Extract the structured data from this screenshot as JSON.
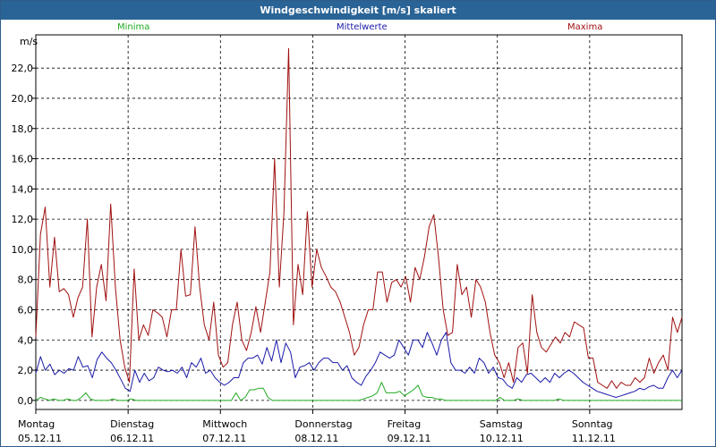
{
  "window": {
    "title": "Windgeschwindigkeit [m/s] skaliert"
  },
  "legend": {
    "min_label": "Minima",
    "mean_label": "Mittelwerte",
    "max_label": "Maxima"
  },
  "colors": {
    "minima": "#22aa22",
    "mittelwerte": "#1a1aa8",
    "maxima": "#a01010",
    "title_bg": "#2a6496"
  },
  "chart_data": {
    "type": "line",
    "title": "Windgeschwindigkeit [m/s] skaliert",
    "ylabel": "m/s",
    "ylim": [
      -0.6,
      24.2
    ],
    "xlim": [
      0,
      7
    ],
    "yticks": [
      "0,0",
      "2,0",
      "4,0",
      "6,0",
      "8,0",
      "10,0",
      "12,0",
      "14,0",
      "16,0",
      "18,0",
      "20,0",
      "22,0"
    ],
    "xticks": [
      {
        "day": "Montag",
        "date": "05.12.11"
      },
      {
        "day": "Dienstag",
        "date": "06.12.11"
      },
      {
        "day": "Mittwoch",
        "date": "07.12.11"
      },
      {
        "day": "Donnerstag",
        "date": "08.12.11"
      },
      {
        "day": "Freitag",
        "date": "09.12.11"
      },
      {
        "day": "Samstag",
        "date": "10.12.11"
      },
      {
        "day": "Sonntag",
        "date": "11.12.11"
      }
    ],
    "grid": true,
    "legend_position": "top",
    "series": [
      {
        "name": "Maxima",
        "values": [
          4.2,
          11.0,
          12.8,
          7.5,
          10.8,
          7.2,
          7.4,
          7.0,
          5.5,
          6.8,
          7.5,
          12.0,
          4.2,
          7.5,
          9.0,
          6.6,
          13.0,
          7.5,
          4.0,
          2.2,
          1.2,
          8.7,
          4.0,
          5.0,
          4.3,
          6.0,
          5.8,
          5.5,
          4.2,
          6.0,
          6.0,
          10.0,
          6.9,
          7.0,
          11.5,
          7.5,
          5.0,
          4.0,
          6.5,
          3.0,
          2.2,
          2.5,
          5.0,
          6.5,
          4.0,
          3.3,
          4.5,
          6.2,
          4.5,
          6.5,
          8.5,
          16.0,
          7.5,
          12.5,
          23.3,
          5.0,
          9.0,
          7.0,
          12.5,
          7.5,
          10.0,
          8.8,
          8.2,
          7.5,
          7.2,
          6.5,
          5.5,
          4.5,
          3.0,
          3.5,
          5.0,
          6.0,
          6.0,
          8.5,
          8.5,
          6.5,
          7.8,
          8.0,
          7.5,
          8.2,
          6.5,
          8.8,
          8.0,
          9.5,
          11.5,
          12.3,
          9.5,
          6.0,
          4.3,
          4.5,
          9.0,
          7.0,
          7.5,
          5.5,
          8.0,
          7.5,
          6.5,
          4.5,
          3.0,
          2.5,
          1.5,
          2.5,
          1.2,
          3.5,
          3.8,
          1.8,
          7.0,
          4.5,
          3.5,
          3.2,
          3.7,
          4.2,
          3.8,
          4.5,
          4.2,
          5.2,
          5.0,
          4.8,
          2.8,
          2.8,
          1.2,
          1.0,
          0.8,
          1.3,
          0.8,
          1.2,
          1.0,
          1.0,
          1.5,
          1.2,
          1.5,
          2.8,
          1.8,
          2.5,
          3.0,
          2.0,
          5.5,
          4.5,
          5.5
        ]
      },
      {
        "name": "Mittelwerte",
        "values": [
          1.8,
          2.9,
          2.0,
          2.4,
          1.7,
          2.0,
          1.8,
          2.1,
          2.0,
          2.9,
          2.2,
          2.3,
          1.5,
          2.7,
          3.2,
          2.8,
          2.5,
          2.0,
          1.4,
          0.8,
          0.6,
          2.0,
          1.2,
          1.8,
          1.3,
          1.5,
          2.2,
          2.0,
          1.9,
          2.0,
          1.8,
          2.2,
          1.5,
          2.5,
          2.2,
          2.8,
          1.8,
          2.0,
          1.5,
          1.2,
          1.0,
          1.2,
          1.5,
          1.5,
          2.5,
          2.8,
          2.8,
          3.0,
          2.4,
          3.5,
          2.6,
          4.0,
          2.5,
          3.8,
          3.2,
          1.5,
          2.2,
          2.3,
          2.5,
          2.0,
          2.5,
          2.8,
          2.8,
          2.5,
          2.5,
          2.0,
          2.3,
          1.5,
          1.2,
          1.0,
          1.6,
          2.0,
          2.5,
          3.2,
          3.0,
          2.8,
          3.0,
          4.0,
          3.5,
          3.0,
          4.0,
          4.0,
          3.5,
          4.5,
          3.8,
          3.0,
          4.0,
          4.5,
          2.5,
          2.0,
          2.0,
          1.8,
          2.2,
          1.8,
          2.8,
          2.5,
          1.8,
          2.2,
          1.5,
          1.4,
          1.0,
          0.8,
          1.5,
          1.2,
          1.7,
          1.8,
          1.5,
          1.2,
          1.5,
          1.2,
          1.8,
          1.5,
          1.8,
          2.0,
          1.8,
          1.5,
          1.2,
          1.0,
          0.8,
          0.6,
          0.5,
          0.4,
          0.3,
          0.2,
          0.3,
          0.4,
          0.5,
          0.6,
          0.8,
          0.7,
          0.9,
          1.0,
          0.8,
          0.8,
          1.5,
          2.0,
          1.5,
          2.0
        ]
      },
      {
        "name": "Minima",
        "values": [
          0.0,
          0.2,
          0.1,
          0.0,
          0.1,
          0.0,
          0.0,
          0.1,
          0.0,
          0.0,
          0.2,
          0.5,
          0.1,
          0.0,
          0.0,
          0.0,
          0.0,
          0.1,
          0.0,
          0.0,
          0.0,
          0.1,
          0.0,
          0.0,
          0.0,
          0.0,
          0.0,
          0.0,
          0.0,
          0.0,
          0.0,
          0.0,
          0.0,
          0.0,
          0.0,
          0.0,
          0.0,
          0.0,
          0.0,
          0.0,
          0.0,
          0.0,
          0.0,
          0.0,
          0.5,
          0.0,
          0.2,
          0.7,
          0.7,
          0.8,
          0.8,
          0.2,
          0.0,
          0.0,
          0.0,
          0.0,
          0.0,
          0.0,
          0.0,
          0.0,
          0.0,
          0.0,
          0.0,
          0.0,
          0.0,
          0.0,
          0.0,
          0.0,
          0.0,
          0.0,
          0.0,
          0.0,
          0.1,
          0.2,
          0.3,
          0.5,
          1.2,
          0.5,
          0.5,
          0.5,
          0.6,
          0.3,
          0.5,
          0.7,
          1.0,
          0.3,
          0.2,
          0.2,
          0.1,
          0.1,
          0.0,
          0.0,
          0.0,
          0.0,
          0.0,
          0.0,
          0.0,
          0.0,
          0.0,
          0.0,
          0.0,
          0.0,
          0.2,
          0.0,
          0.0,
          0.0,
          0.1,
          0.0,
          0.0,
          0.0,
          0.0,
          0.0,
          0.0,
          0.0,
          0.0,
          0.1,
          0.0,
          0.0,
          0.0,
          0.0,
          0.0,
          0.0,
          0.0,
          0.0,
          0.0,
          0.0,
          0.0,
          0.0,
          0.0,
          0.0,
          0.0,
          0.0,
          0.0,
          0.0,
          0.0,
          0.0,
          0.0,
          0.0,
          0.0,
          0.0,
          0.0,
          0.0,
          0.0
        ]
      }
    ]
  }
}
